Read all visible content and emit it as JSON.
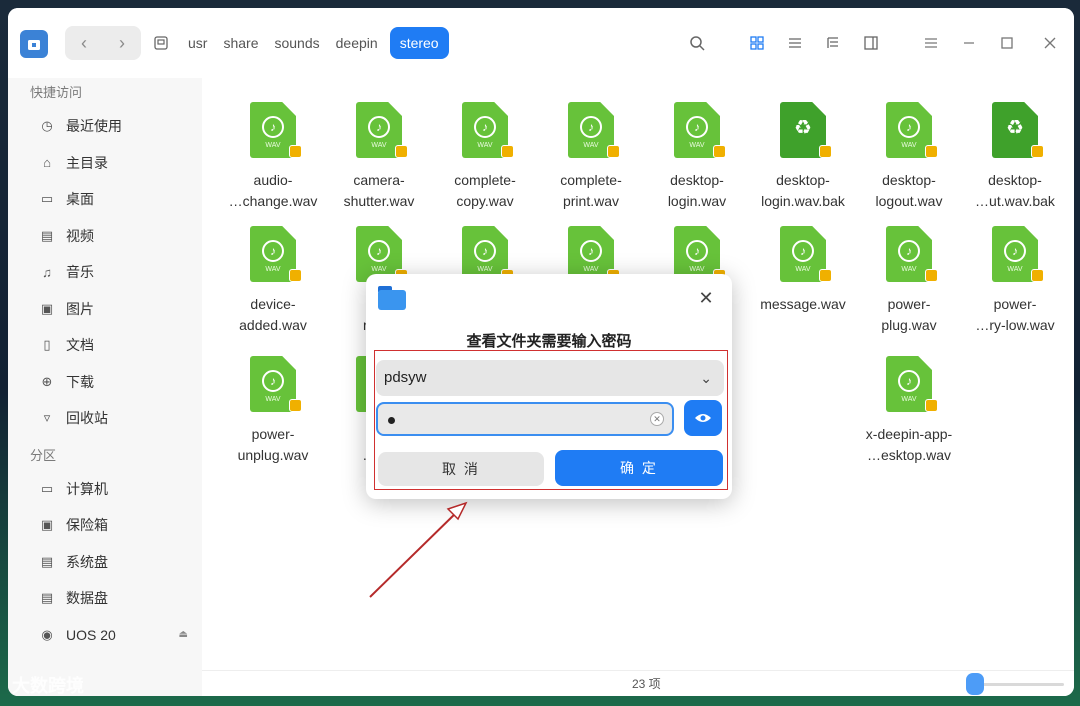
{
  "breadcrumbs": [
    "usr",
    "share",
    "sounds",
    "deepin",
    "stereo"
  ],
  "sidebar": {
    "quick_access_header": "快捷访问",
    "quick_items": [
      {
        "label": "最近使用",
        "icon": "clock-icon"
      },
      {
        "label": "主目录",
        "icon": "home-icon"
      },
      {
        "label": "桌面",
        "icon": "desktop-icon"
      },
      {
        "label": "视频",
        "icon": "video-icon"
      },
      {
        "label": "音乐",
        "icon": "music-icon"
      },
      {
        "label": "图片",
        "icon": "picture-icon"
      },
      {
        "label": "文档",
        "icon": "document-icon"
      },
      {
        "label": "下载",
        "icon": "download-icon"
      },
      {
        "label": "回收站",
        "icon": "trash-icon"
      }
    ],
    "partitions_header": "分区",
    "partition_items": [
      {
        "label": "计算机",
        "icon": "computer-icon"
      },
      {
        "label": "保险箱",
        "icon": "safe-icon"
      },
      {
        "label": "系统盘",
        "icon": "disk-icon"
      },
      {
        "label": "数据盘",
        "icon": "disk-icon"
      },
      {
        "label": "UOS 20",
        "icon": "disc-icon"
      }
    ]
  },
  "files": [
    {
      "line1": "audio-",
      "line2": "…change.wav",
      "type": "wav"
    },
    {
      "line1": "camera-",
      "line2": "shutter.wav",
      "type": "wav"
    },
    {
      "line1": "complete-",
      "line2": "copy.wav",
      "type": "wav"
    },
    {
      "line1": "complete-",
      "line2": "print.wav",
      "type": "wav"
    },
    {
      "line1": "desktop-",
      "line2": "login.wav",
      "type": "wav"
    },
    {
      "line1": "desktop-",
      "line2": "login.wav.bak",
      "type": "bak"
    },
    {
      "line1": "desktop-",
      "line2": "logout.wav",
      "type": "wav"
    },
    {
      "line1": "desktop-",
      "line2": "…ut.wav.bak",
      "type": "bak"
    },
    {
      "line1": "device-",
      "line2": "added.wav",
      "type": "wav"
    },
    {
      "line1": "de",
      "line2": "remo",
      "type": "wav"
    },
    {
      "line1": "",
      "line2": "",
      "type": "wav"
    },
    {
      "line1": "",
      "line2": "",
      "type": "wav"
    },
    {
      "line1": "",
      "line2": "",
      "type": "wav"
    },
    {
      "line1": "message.wav",
      "line2": "",
      "type": "wav"
    },
    {
      "line1": "power-",
      "line2": "plug.wav",
      "type": "wav"
    },
    {
      "line1": "power-",
      "line2": "…ry-low.wav",
      "type": "wav"
    },
    {
      "line1": "power-",
      "line2": "unplug.wav",
      "type": "wav"
    },
    {
      "line1": "sc",
      "line2": "…mp",
      "type": "wav"
    },
    {
      "line1": "trash-",
      "line2": "empty.wav",
      "type": "wav"
    },
    {
      "line1": "x-deepin-app-",
      "line2": "…esktop.wav",
      "type": "wav"
    }
  ],
  "status": {
    "count": "23 项"
  },
  "dialog": {
    "title": "查看文件夹需要输入密码",
    "user": "pdsyw",
    "cancel": "取 消",
    "confirm": "确 定"
  },
  "icon_wav_text": "WAV",
  "watermark": "大数跨境",
  "colors": {
    "accent": "#1f7cf4",
    "file_green": "#67c23a",
    "annotation_red": "#d03030"
  }
}
